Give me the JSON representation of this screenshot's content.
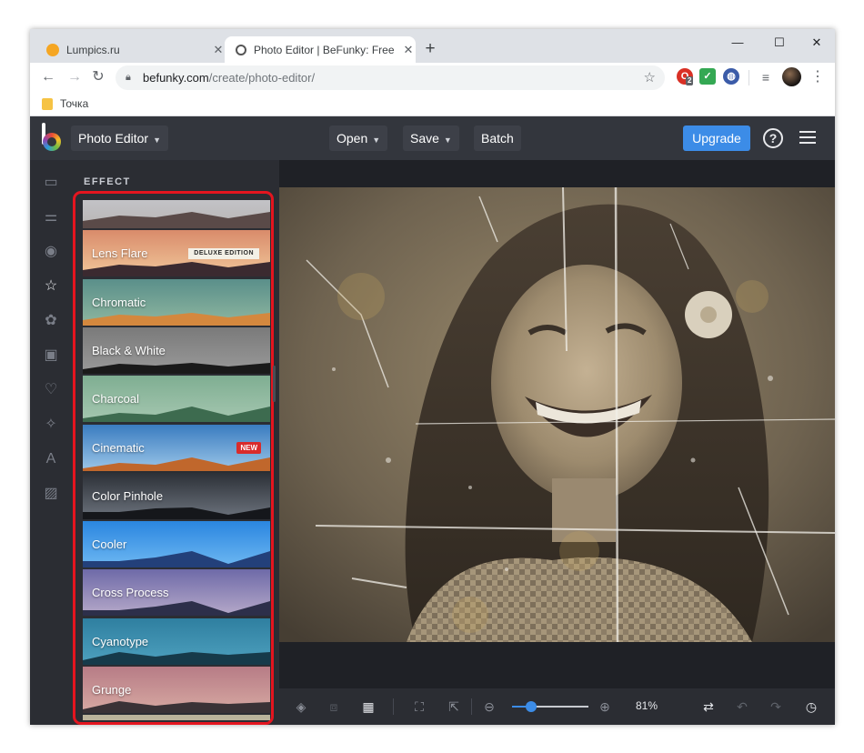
{
  "browser": {
    "tabs": [
      {
        "title": "Lumpics.ru",
        "favicon_color": "#f5a623",
        "active": false
      },
      {
        "title": "Photo Editor | BeFunky: Free Onli",
        "favicon_color": "#ffffff",
        "active": true
      }
    ],
    "new_tab_icon": "plus-icon",
    "window_controls": {
      "minimize": "—",
      "maximize": "☐",
      "close": "✕"
    },
    "nav": {
      "back": "←",
      "forward": "→",
      "reload": "↻"
    },
    "url": {
      "host": "befunky.com",
      "path": "/create/photo-editor/"
    },
    "extensions": [
      {
        "name": "extension-red-icon",
        "color": "#d93025",
        "glyph": "O",
        "badge": "2"
      },
      {
        "name": "extension-check-icon",
        "color": "#34a853",
        "glyph": "✓"
      },
      {
        "name": "extension-globe-icon",
        "color": "#3b5ba8",
        "glyph": "◍"
      }
    ],
    "bookmarks": [
      {
        "label": "Точка"
      }
    ]
  },
  "app": {
    "title_button": "Photo Editor",
    "menu": {
      "open": "Open",
      "save": "Save",
      "batch": "Batch"
    },
    "upgrade": "Upgrade",
    "help": "?",
    "colors": {
      "accent": "#3c8ce7",
      "highlight": "#e4151f",
      "panel": "#2b2d33"
    }
  },
  "rail": [
    {
      "name": "image-manager-icon",
      "glyph": "▭",
      "active": false
    },
    {
      "name": "edit-sliders-icon",
      "glyph": "⚌",
      "active": false
    },
    {
      "name": "touch-up-eye-icon",
      "glyph": "◉",
      "active": false
    },
    {
      "name": "effects-star-icon",
      "glyph": "☆",
      "active": true
    },
    {
      "name": "artsy-icon",
      "glyph": "✿",
      "active": false
    },
    {
      "name": "frames-icon",
      "glyph": "▣",
      "active": false
    },
    {
      "name": "graphics-heart-icon",
      "glyph": "♡",
      "active": false
    },
    {
      "name": "overlays-icon",
      "glyph": "✧",
      "active": false
    },
    {
      "name": "text-icon",
      "glyph": "A",
      "active": false
    },
    {
      "name": "textures-icon",
      "glyph": "▨",
      "active": false
    }
  ],
  "panel": {
    "title": "EFFECT",
    "effects": [
      {
        "label": "",
        "sky": [
          "#c9cbd2",
          "#b8b5b4"
        ],
        "land": "#5a4a48"
      },
      {
        "label": "Lens Flare",
        "sky": [
          "#d98b6b",
          "#f1c79a"
        ],
        "land": "#3b2a30",
        "badge": "DELUXE EDITION"
      },
      {
        "label": "Chromatic",
        "sky": [
          "#5a8f8a",
          "#8fb7a0"
        ],
        "land": "#d4883e"
      },
      {
        "label": "Black & White",
        "sky": [
          "#7a7a7a",
          "#9a9a9a"
        ],
        "land": "#1a1a1a"
      },
      {
        "label": "Charcoal",
        "sky": [
          "#7fae92",
          "#a5c7b0"
        ],
        "land": "#3d6b4f"
      },
      {
        "label": "Cinematic",
        "sky": [
          "#3a7cc0",
          "#9cc6e8"
        ],
        "land": "#c0672c",
        "badge_new": "NEW"
      },
      {
        "label": "Color Pinhole",
        "sky": [
          "#2c3037",
          "#6d747e"
        ],
        "land": "#15171b"
      },
      {
        "label": "Cooler",
        "sky": [
          "#2a86e0",
          "#6eb8f2"
        ],
        "land": "#23407a"
      },
      {
        "label": "Cross Process",
        "sky": [
          "#6e6aa8",
          "#b6a9c9"
        ],
        "land": "#2d2f4a"
      },
      {
        "label": "Cyanotype",
        "sky": [
          "#2f7fa0",
          "#4ea1bf"
        ],
        "land": "#163a4a"
      },
      {
        "label": "Grunge",
        "sky": [
          "#b77c86",
          "#d7a9a2"
        ],
        "land": "#3a3236"
      },
      {
        "label": "",
        "sky": [
          "#b9b29a",
          "#cfc6ad"
        ],
        "land": "#8a8370"
      }
    ]
  },
  "bottombar": {
    "zoom": "81%",
    "zoom_level": 0.25,
    "icons": [
      "layers-icon",
      "crop-disabled-icon",
      "layout-icon",
      "fit-screen-icon",
      "expand-icon",
      "zoom-out-icon",
      "zoom-in-icon",
      "compare-icon",
      "undo-icon",
      "redo-icon",
      "history-icon"
    ]
  }
}
